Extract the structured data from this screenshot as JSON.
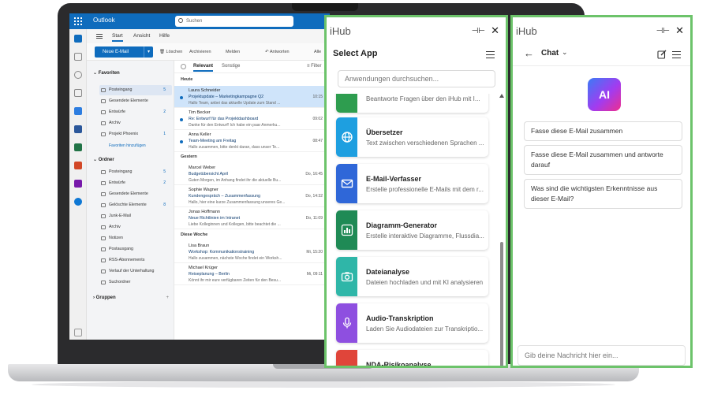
{
  "outlook": {
    "brand": "Outlook",
    "search_placeholder": "Suchen",
    "tabs": [
      "Start",
      "Ansicht",
      "Hilfe"
    ],
    "ribbon": {
      "new_mail": "Neue E-Mail",
      "delete": "Löschen",
      "archive": "Archivieren",
      "report": "Melden",
      "reply": "Antworten",
      "all": "Alle"
    },
    "favorites": {
      "header": "Favoriten",
      "items": [
        {
          "label": "Posteingang",
          "count": "5"
        },
        {
          "label": "Gesendete Elemente",
          "count": ""
        },
        {
          "label": "Entwürfe",
          "count": "2"
        },
        {
          "label": "Archiv",
          "count": ""
        },
        {
          "label": "Projekt Phoenix",
          "count": "1"
        }
      ],
      "add_link": "Favoriten hinzufügen"
    },
    "folders": {
      "header": "Ordner",
      "items": [
        {
          "label": "Posteingang",
          "count": "5"
        },
        {
          "label": "Entwürfe",
          "count": "2"
        },
        {
          "label": "Gesendete Elemente",
          "count": ""
        },
        {
          "label": "Gelöschte Elemente",
          "count": "8"
        },
        {
          "label": "Junk-E-Mail",
          "count": ""
        },
        {
          "label": "Archiv",
          "count": ""
        },
        {
          "label": "Notizen",
          "count": ""
        },
        {
          "label": "Postausgang",
          "count": ""
        },
        {
          "label": "RSS-Abonnements",
          "count": ""
        },
        {
          "label": "Verlauf der Unterhaltung",
          "count": ""
        },
        {
          "label": "Suchordner",
          "count": ""
        }
      ]
    },
    "groups_header": "Gruppen",
    "list": {
      "tab_relevant": "Relevant",
      "tab_other": "Sonstige",
      "filter": "Filter",
      "section_today": "Heute",
      "section_yesterday": "Gestern",
      "section_week": "Diese Woche",
      "messages": [
        {
          "from": "Laura Schneider",
          "subject": "Projektupdate – Marketingkampagne Q2",
          "time": "10:15",
          "preview": "Hallo Team, anbei das aktuelle Update zum Stand ..."
        },
        {
          "from": "Tim Becker",
          "subject": "Re: Entwurf für das Projektdashboard",
          "time": "09:02",
          "preview": "Danke für den Entwurf! Ich habe ein paar Anmerku..."
        },
        {
          "from": "Anna Keller",
          "subject": "Team-Meeting am Freitag",
          "time": "08:47",
          "preview": "Hallo zusammen, bitte denkt daran, dass unser Te..."
        },
        {
          "from": "Marcel Weber",
          "subject": "Budgetübersicht April",
          "time": "Do, 16:45",
          "preview": "Guten Morgen, im Anhang findet ihr die aktuelle Bu..."
        },
        {
          "from": "Sophie Wagner",
          "subject": "Kundengespräch – Zusammenfassung",
          "time": "Do, 14:32",
          "preview": "Hallo, hier eine kurze Zusammenfassung unseres Ge..."
        },
        {
          "from": "Jonas Hoffmann",
          "subject": "Neue Richtlinien im Intranet",
          "time": "Do, 11:09",
          "preview": "Liebe Kolleginnen und Kollegen, bitte beachtet die ..."
        },
        {
          "from": "Lisa Braun",
          "subject": "Workshop: Kommunikationstraining",
          "time": "Mi, 15:20",
          "preview": "Hallo zusammen, nächste Woche findet ein Worksh..."
        },
        {
          "from": "Michael Krüger",
          "subject": "Reiseplanung – Berlin",
          "time": "Mi, 09:11",
          "preview": "Könnt ihr mir eure verfügbaren Zeiten für den Besu..."
        }
      ]
    }
  },
  "select_app_panel": {
    "brand": "iHub",
    "title": "Select App",
    "search_placeholder": "Anwendungen durchsuchen...",
    "apps": [
      {
        "name": "",
        "desc": "Beantworte Fragen über den iHub mit I...",
        "color": "#2e9d4f",
        "icon": "chat-icon"
      },
      {
        "name": "Übersetzer",
        "desc": "Text zwischen verschiedenen Sprachen ...",
        "color": "#1e9fe0",
        "icon": "globe-icon"
      },
      {
        "name": "E-Mail-Verfasser",
        "desc": "Erstelle professionelle E-Mails mit dem r...",
        "color": "#2f67d8",
        "icon": "mail-icon"
      },
      {
        "name": "Diagramm-Generator",
        "desc": "Erstelle interaktive Diagramme, Flussdia...",
        "color": "#1f8a55",
        "icon": "bar-chart-icon"
      },
      {
        "name": "Dateianalyse",
        "desc": "Dateien hochladen und mit KI analysieren",
        "color": "#2fb6a8",
        "icon": "camera-icon"
      },
      {
        "name": "Audio-Transkription",
        "desc": "Laden Sie Audiodateien zur Transkriptio...",
        "color": "#8e4fe0",
        "icon": "microphone-icon"
      },
      {
        "name": "NDA-Risikoanalyse",
        "desc": "",
        "color": "#e0453a",
        "icon": "shield-icon"
      }
    ]
  },
  "chat_panel": {
    "brand": "iHub",
    "title": "Chat",
    "logo_text": "AI",
    "suggestions": [
      "Fasse diese E-Mail zusammen",
      "Fasse diese E-Mail zusammen und antworte darauf",
      "Was sind die wichtigsten Erkenntnisse aus dieser E-Mail?"
    ],
    "input_placeholder": "Gib deine Nachricht hier ein..."
  }
}
